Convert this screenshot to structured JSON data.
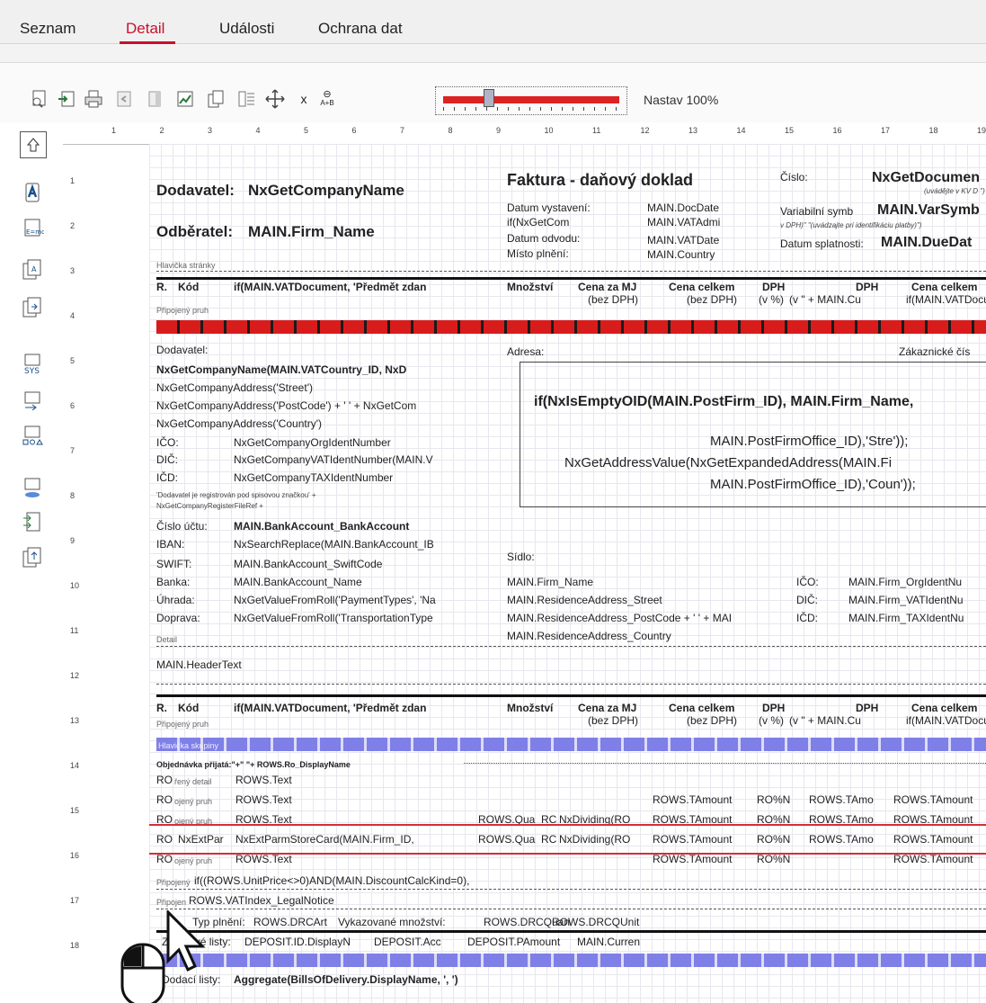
{
  "tabs": {
    "list": "Seznam",
    "detail": "Detail",
    "events": "Události",
    "privacy": "Ochrana dat"
  },
  "toolbar": {
    "x_label": "x",
    "formula_label": "A+B",
    "zoom_label": "Nastav 100%",
    "zoom_level": 0.24
  },
  "ruler": [
    "1",
    "2",
    "3",
    "4",
    "5",
    "6",
    "7",
    "8",
    "9",
    "10",
    "11",
    "12",
    "13",
    "14",
    "15",
    "16",
    "17",
    "18",
    "19"
  ],
  "rows": [
    "1",
    "2",
    "3",
    "4",
    "5",
    "6",
    "7",
    "8",
    "9",
    "10",
    "11",
    "12",
    "13",
    "14",
    "15",
    "16",
    "17",
    "18"
  ],
  "header": {
    "dodavatel_label": "Dodavatel:",
    "company_name": "NxGetCompanyName",
    "odberatel_label": "Odběratel:",
    "firm_name": "MAIN.Firm_Name",
    "title": "Faktura - daňový doklad",
    "cislo_label": "Číslo:",
    "doc_number": "NxGetDocumen",
    "vat_note": "(uvádějte v KV D \")",
    "datum_vystaveni": "Datum vystavení:",
    "doc_date": "MAIN.DocDate",
    "if_nxget": "if(NxGetCom",
    "vat_admit": "MAIN.VATAdmi",
    "datum_odvodu": "Datum odvodu:",
    "vat_date": "MAIN.VATDate",
    "misto_plneni": "Místo plnění:",
    "country": "MAIN.Country",
    "var_symbol_label": "Variabilní symb",
    "var_symbol": "MAIN.VarSymb",
    "dph_note": "v DPH)\"  \"(uvádzajte pri identifikáciu platby)\")",
    "splatnost_label": "Datum splatnosti:",
    "due_date": "MAIN.DueDat",
    "page_header": "Hlavička stránky"
  },
  "columns": {
    "r": "R.",
    "kod": "Kód",
    "predmet": "if(MAIN.VATDocument, 'Předmět zdan",
    "mnozstvi": "Množství",
    "cena_mj": "Cena za MJ",
    "bez_dph1": "(bez DPH)",
    "cena_celkem": "Cena celkem",
    "bez_dph2": "(bez DPH)",
    "dph": "DPH",
    "v_pct": "(v %)",
    "dph2": "DPH",
    "v_main": "(v \" + MAIN.Cu",
    "cena_celkem2": "Cena celkem",
    "if_vatdoc": "if(MAIN.VATDocu",
    "pripojeny_pruh": "Připojený pruh"
  },
  "supplier": {
    "label": "Dodavatel:",
    "l1": "NxGetCompanyName(MAIN.VATCountry_ID, NxD",
    "l2": "NxGetCompanyAddress('Street')",
    "l3": "NxGetCompanyAddress('PostCode')  + '  ' + NxGetCom",
    "l4": "NxGetCompanyAddress('Country')",
    "ico_label": "IČO:",
    "ico": "NxGetCompanyOrgIdentNumber",
    "dic_label": "DIČ:",
    "dic": "NxGetCompanyVATIdentNumber(MAIN.V",
    "icd_label": "IČD:",
    "icd": "NxGetCompanyTAXIdentNumber",
    "reg1": "'Dodavatel je registrován pod spisovou značkou' +",
    "reg2": "NxGetCompanyRegisterFileRef +",
    "ucet_label": "Číslo účtu:",
    "ucet": "MAIN.BankAccount_BankAccount",
    "iban_label": "IBAN:",
    "iban": "NxSearchReplace(MAIN.BankAccount_IB",
    "swift_label": "SWIFT:",
    "swift": "MAIN.BankAccount_SwiftCode",
    "banka_label": "Banka:",
    "banka": "MAIN.BankAccount_Name",
    "uhrada_label": "Úhrada:",
    "uhrada": "NxGetValueFromRoll('PaymentTypes', 'Na",
    "doprava_label": "Doprava:",
    "doprava": "NxGetValueFromRoll('TransportationType"
  },
  "address": {
    "label": "Adresa:",
    "zakaznicke": "Zákaznické čís",
    "expr1": "if(NxIsEmptyOID(MAIN.PostFirm_ID), MAIN.Firm_Name,",
    "expr2": "MAIN.PostFirmOffice_ID),'Stre'));",
    "expr3": "NxGetAddressValue(NxGetExpandedAddress(MAIN.Fi",
    "expr4": "MAIN.PostFirmOffice_ID),'Coun'));",
    "sidlo": "Sídlo:",
    "firm_name": "MAIN.Firm_Name",
    "street": "MAIN.ResidenceAddress_Street",
    "postcode": "MAIN.ResidenceAddress_PostCode + '  ' + MAI",
    "country": "MAIN.ResidenceAddress_Country",
    "ico_label": "IČO:",
    "ico": "MAIN.Firm_OrgIdentNu",
    "dic_label": "DIČ:",
    "dic": "MAIN.Firm_VATIdentNu",
    "icd_label": "IČD:",
    "icd": "MAIN.Firm_TAXIdentNu"
  },
  "detail": {
    "detail_label": "Detail",
    "header_text": "MAIN.HeaderText",
    "hlavicka_skupiny": "Hlavička skupiny",
    "objednavka": "Objednávka přijatá:\"+\" \"+ ROWS.Ro_DisplayName",
    "ro": "RO",
    "reny_detail": "řený detail",
    "rows_text": "ROWS.Text",
    "ojeny_pruh": "ojený pruh",
    "tamount": "ROWS.TAmount",
    "ron": "RO%N",
    "tamo": "ROWS.TAmo",
    "qua": "ROWS.Qua",
    "rc": "RC",
    "nxdividing": "NxDividing(RO",
    "nxextpar": "NxExtPar",
    "storecard": "NxExtParmStoreCard(MAIN.Firm_ID,",
    "pripojeny_prefix": "Připojený",
    "unitprice_if": "if((ROWS.UnitPrice<>0)AND(MAIN.DiscountCalcKind=0),",
    "pripojen": "Připojen",
    "vatindex": "ROWS.VATIndex_LegalNotice",
    "typ_plneni": "Typ plnění:",
    "drcart": "ROWS.DRCArt",
    "vykaz_mnozstvi": "Vykazované množství:",
    "drcquan": "ROWS.DRCQuan",
    "drcqunit": "ROWS.DRCQUnit",
    "zalohove_listy": "Zálohové listy:",
    "deposit_id": "DEPOSIT.ID.DisplayN",
    "deposit_acc": "DEPOSIT.Acc",
    "deposit_pamount": "DEPOSIT.PAmount",
    "main_curren": "MAIN.Curren",
    "dodaci_listy": "Dodací listy:",
    "aggregate": "Aggregate(BillsOfDelivery.DisplayName, ', ')"
  }
}
